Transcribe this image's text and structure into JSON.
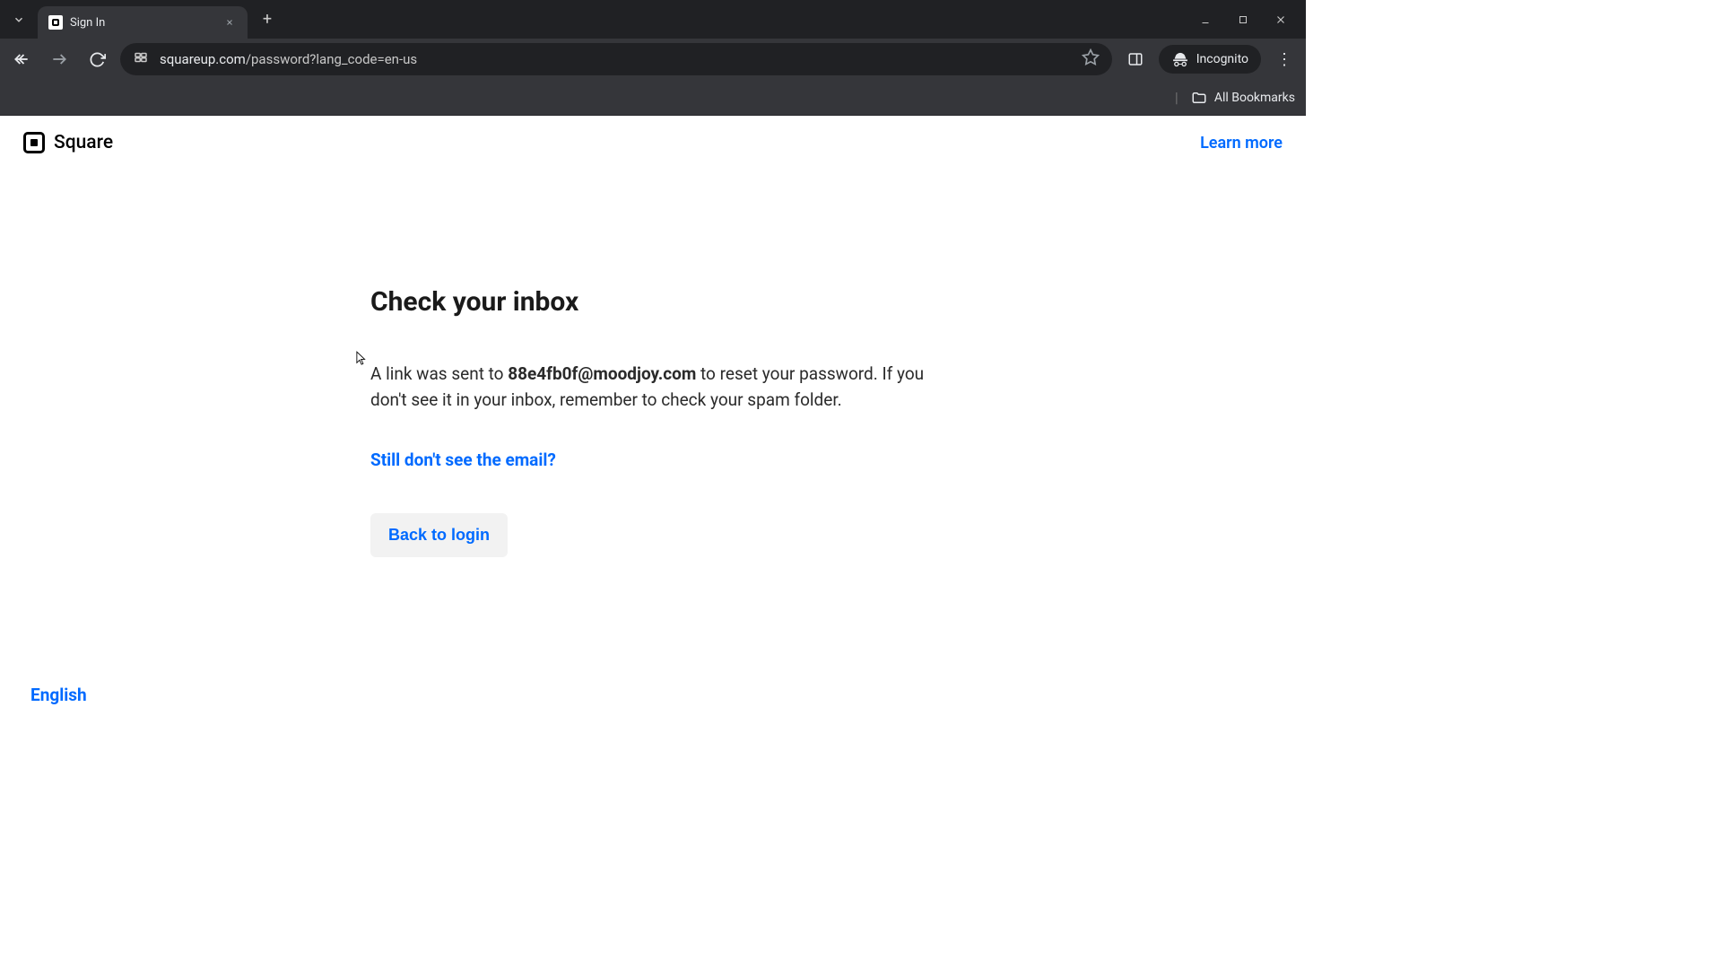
{
  "browser": {
    "tab_title": "Sign In",
    "url_domain": "squareup.com",
    "url_path": "/password?lang_code=en-us",
    "incognito_label": "Incognito",
    "all_bookmarks_label": "All Bookmarks"
  },
  "header": {
    "brand_name": "Square",
    "learn_more": "Learn more"
  },
  "main": {
    "heading": "Check your inbox",
    "body_prefix": "A link was sent to ",
    "email": "88e4fb0f@moodjoy.com",
    "body_suffix": " to reset your password. If you don't see it in your inbox, remember to check your spam folder.",
    "help_link": "Still don't see the email?",
    "back_button": "Back to login"
  },
  "footer": {
    "language": "English"
  }
}
